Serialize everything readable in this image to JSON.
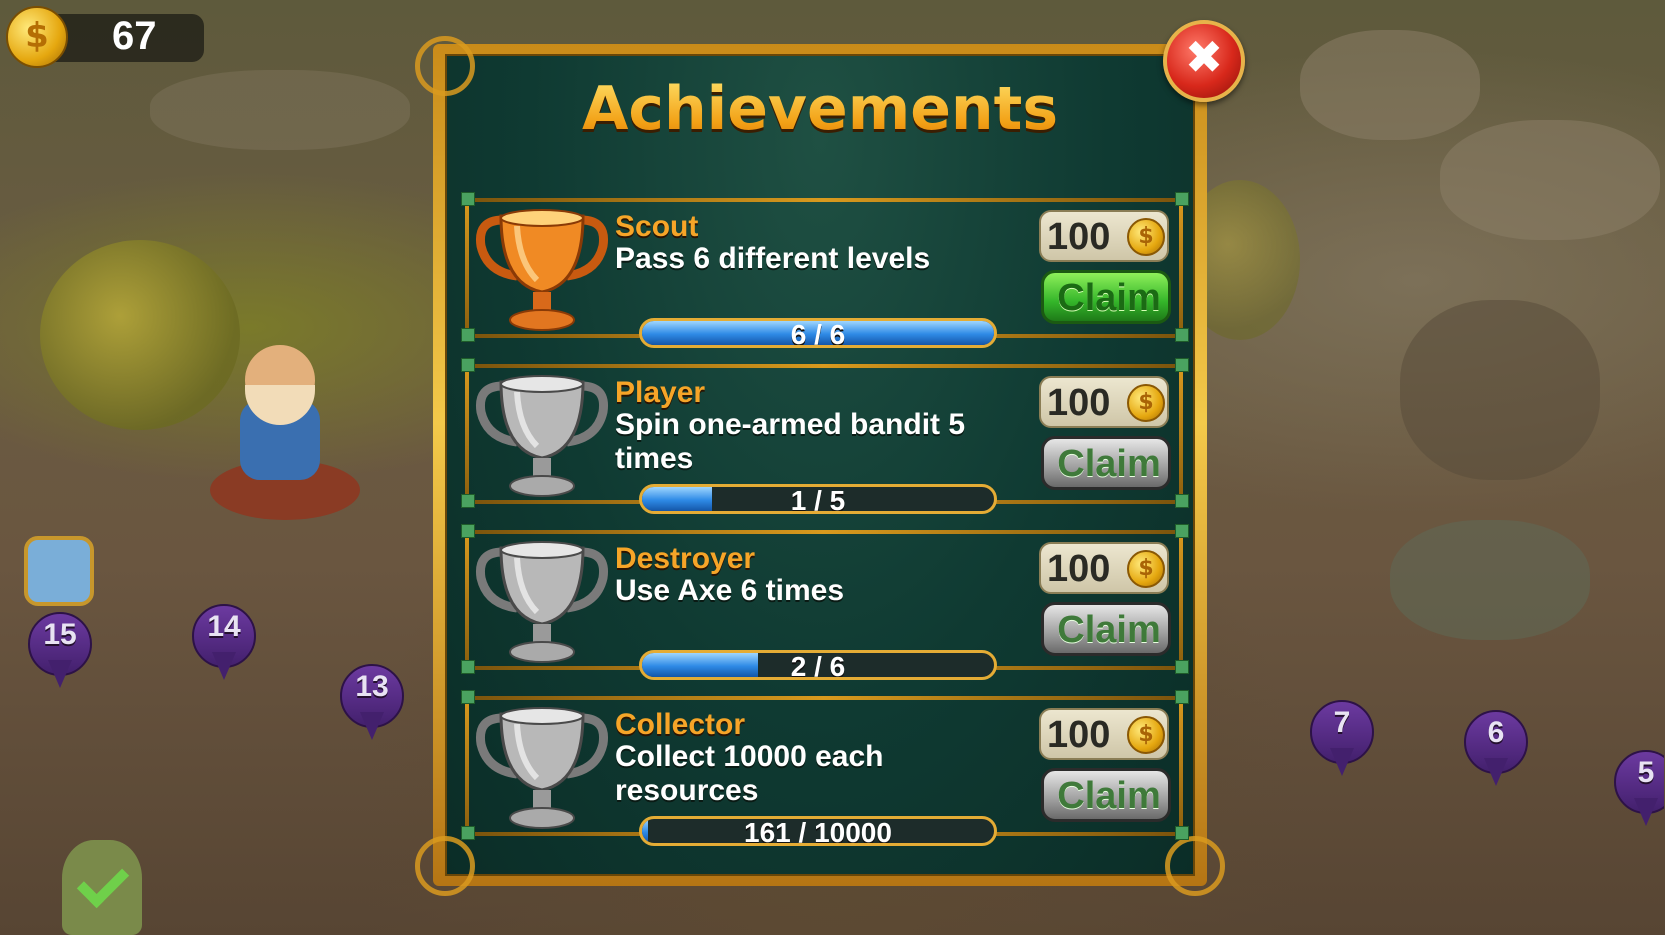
{
  "hud": {
    "coins": "67",
    "coin_icon": "coin-icon"
  },
  "dialog": {
    "title": "Achievements",
    "close_icon": "close-icon",
    "achievements": [
      {
        "name": "Scout",
        "description": "Pass 6 different levels",
        "reward": "100",
        "claim": "Claim",
        "progress": "6 / 6",
        "fraction": 1.0,
        "claimable": true
      },
      {
        "name": "Player",
        "description": "Spin one-armed bandit 5 times",
        "reward": "100",
        "claim": "Claim",
        "progress": "1 / 5",
        "fraction": 0.2,
        "claimable": false
      },
      {
        "name": "Destroyer",
        "description": "Use Axe 6 times",
        "reward": "100",
        "claim": "Claim",
        "progress": "2 / 6",
        "fraction": 0.33,
        "claimable": false
      },
      {
        "name": "Collector",
        "description": "Collect 10000 each resources",
        "reward": "100",
        "claim": "Claim",
        "progress": "161 / 10000",
        "fraction": 0.016,
        "claimable": false
      }
    ]
  },
  "map": {
    "levels": [
      "15",
      "14",
      "13",
      "7",
      "6",
      "5"
    ]
  },
  "colors": {
    "gold_trophy": "#e87a1c",
    "silver_trophy": "#b8b8b8",
    "claim_active": "#34b52a",
    "title": "#f6b62d"
  }
}
